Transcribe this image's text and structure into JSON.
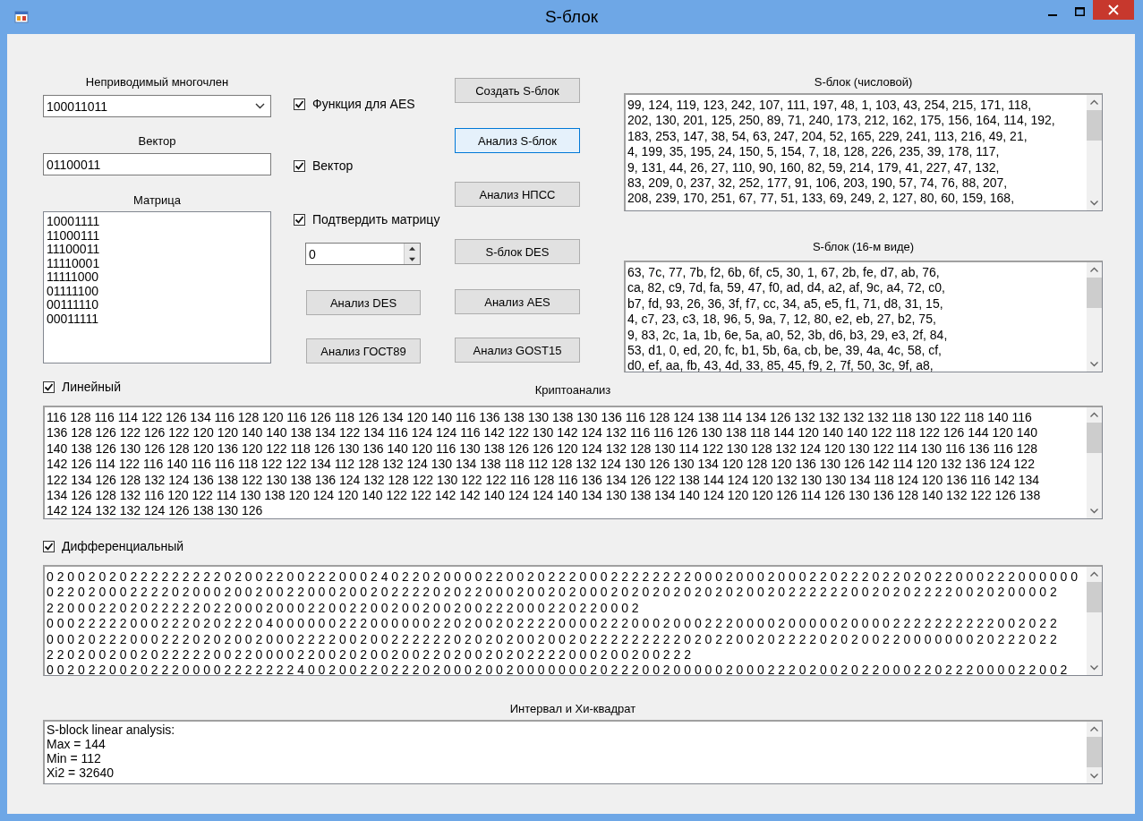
{
  "window": {
    "title": "S-блок"
  },
  "poly": {
    "label": "Неприводимый многочлен",
    "value": "100011011"
  },
  "vector": {
    "label": "Вектор",
    "value": "01100011"
  },
  "matrix": {
    "label": "Матрица",
    "rows": [
      "10001111",
      "11000111",
      "11100011",
      "11110001",
      "11111000",
      "01111100",
      "00111110",
      "00011111"
    ]
  },
  "options": [
    {
      "label": "Функция для AES",
      "checked": true
    },
    {
      "label": "Вектор",
      "checked": true
    },
    {
      "label": "Подтвердить матрицу",
      "checked": true
    }
  ],
  "spinner": {
    "value": "0"
  },
  "buttons_left": [
    {
      "label": "Анализ DES",
      "highlighted": false
    },
    {
      "label": "Анализ ГОСТ89",
      "highlighted": false
    }
  ],
  "buttons_right": [
    {
      "label": "Создать S-блок",
      "highlighted": false
    },
    {
      "label": "Анализ S-блок",
      "highlighted": true
    },
    {
      "label": "Анализ НПСС",
      "highlighted": false
    },
    {
      "label": "S-блок DES",
      "highlighted": false
    },
    {
      "label": "Анализ AES",
      "highlighted": false
    },
    {
      "label": "Анализ GOST15",
      "highlighted": false
    }
  ],
  "sbox_dec": {
    "label": "S-блок (числовой)",
    "lines": [
      "99, 124, 119, 123, 242, 107, 111, 197, 48, 1, 103, 43, 254, 215, 171, 118,",
      "202, 130, 201, 125, 250, 89, 71, 240, 173, 212, 162, 175, 156, 164, 114, 192,",
      "183, 253, 147, 38, 54, 63, 247, 204, 52, 165, 229, 241, 113, 216, 49, 21,",
      "4, 199, 35, 195, 24, 150, 5, 154, 7, 18, 128, 226, 235, 39, 178, 117,",
      "9, 131, 44, 26, 27, 110, 90, 160, 82, 59, 214, 179, 41, 227, 47, 132,",
      "83, 209, 0, 237, 32, 252, 177, 91, 106, 203, 190, 57, 74, 76, 88, 207,",
      "208, 239, 170, 251, 67, 77, 51, 133, 69, 249, 2, 127, 80, 60, 159, 168,"
    ]
  },
  "sbox_hex": {
    "label": "S-блок (16-м виде)",
    "lines": [
      "63, 7c, 77, 7b, f2, 6b, 6f, c5, 30, 1, 67, 2b, fe, d7, ab, 76,",
      "ca, 82, c9, 7d, fa, 59, 47, f0, ad, d4, a2, af, 9c, a4, 72, c0,",
      "b7, fd, 93, 26, 36, 3f, f7, cc, 34, a5, e5, f1, 71, d8, 31, 15,",
      "4, c7, 23, c3, 18, 96, 5, 9a, 7, 12, 80, e2, eb, 27, b2, 75,",
      "9, 83, 2c, 1a, 1b, 6e, 5a, a0, 52, 3b, d6, b3, 29, e3, 2f, 84,",
      "53, d1, 0, ed, 20, fc, b1, 5b, 6a, cb, be, 39, 4a, 4c, 58, cf,",
      "d0, ef, aa, fb, 43, 4d, 33, 85, 45, f9, 2, 7f, 50, 3c, 9f, a8,"
    ]
  },
  "linear": {
    "checkbox": {
      "label": "Линейный",
      "checked": true
    },
    "label": "Криптоанализ",
    "lines": [
      "116 128 116 114 122 126 134 116 128 120 116 126 118 126 134 120 140 116 136 138 130 138 130 136 116 128 124 138 114 134 126 132 132 132 132 118 130 122 118 140 116",
      "136 128 126 122 126 122 120 120 140 140 138 134 122 134 116 124 124 116 142 122 130 142 124 132 116 116 126 130 138 118 144 120 140 140 122 118 122 126 144 120 140",
      "140 138 126 130 126 128 120 136 120 122 118 126 130 136 140 120 116 130 138 126 126 120 124 132 128 130 114 122 130 128 132 124 120 130 122 114 130 116 136 116 128",
      "142 126 114 122 116 140 116 116 118 122 122 134 112 128 132 124 130 134 138 118 112 128 132 124 130 126 130 134 120 128 120 136 130 126 142 114 120 132 136 124 122",
      "122 134 126 128 132 124 136 138 122 130 138 136 124 132 128 122 130 122 122 116 128 116 136 134 126 122 138 144 124 120 132 130 130 134 118 124 120 136 116 142 134",
      "134 126 128 132 116 120 122 114 130 138 120 124 120 140 122 122 142 142 140 124 124 140 134 130 138 134 140 124 120 120 126 114 126 130 136 128 140 132 122 126 138",
      "142 124 132 132 124 126 138 130 126"
    ]
  },
  "differential": {
    "checkbox": {
      "label": "Дифференциальный",
      "checked": true
    },
    "lines": [
      "0 2 0 0 2 0 2 0 2 2 2 2 2 2 2 2 2 0 2 0 0 2 2 0 0 2 2 2 0 0 0 2 4 0 2 2 0 2 0 0 0 0 2 2 0 0 2 0 2 2 2 0 0 0 2 2 2 2 2 2 2 2 0 0 0 2 0 0 0 2 0 0 0 2 2 0 2 2 2 0 2 2 0 2 0 2 2 0 0 0 2 2 2 0 0 0 0 0 0",
      "0 2 2 0 2 0 0 0 2 2 2 2 0 2 0 0 0 2 0 0 2 0 0 2 2 0 0 0 2 0 0 2 0 2 2 2 2 0 2 0 2 2 0 0 0 2 0 0 2 0 2 0 0 0 2 0 2 0 2 0 2 0 2 0 2 0 2 0 0 2 0 2 2 2 2 2 2 0 0 2 0 2 0 2 2 2 2 0 0 2 0 2 0 0 0 0 2",
      "2 2 0 0 0 2 2 0 2 0 2 2 2 2 2 0 2 2 0 0 0 2 0 0 0 2 2 0 0 2 2 0 0 2 0 0 2 0 0 2 0 0 2 2 2 0 0 0 2 2 0 2 2 0 0 0 2",
      "0 0 0 2 2 2 2 2 0 0 0 2 2 2 0 2 0 2 2 2 0 4 0 0 0 0 0 0 2 2 2 0 0 0 0 0 0 2 2 0 2 0 0 2 0 2 2 2 2 0 0 0 0 2 2 2 0 0 0 2 0 0 0 2 2 2 0 0 0 0 2 0 0 0 0 0 2 0 0 0 0 2 2 2 2 2 2 2 2 2 2 0 0 2 0 2 2",
      "0 0 0 2 0 2 2 2 0 0 0 2 2 2 0 2 0 2 0 0 2 0 0 0 2 2 2 2 0 0 2 0 0 2 2 2 2 2 2 0 2 0 2 0 2 0 0 2 0 0 2 0 2 2 2 2 2 2 2 2 2 0 2 0 2 2 0 0 2 0 2 2 2 2 0 2 0 2 0 0 2 2 0 0 0 0 0 0 0 2 0 2 2 2 0 2 2",
      "2 2 0 2 0 0 2 0 0 2 0 2 2 2 2 2 0 0 2 2 0 0 0 0 2 2 0 0 2 0 2 0 0 2 0 0 2 2 0 2 0 0 2 0 2 0 2 2 2 2 0 0 0 2 0 0 2 0 0 2 2 2",
      "0 0 2 0 2 2 0 0 2 0 2 2 2 0 0 0 0 2 2 2 2 2 2 2 4 0 0 2 0 0 2 2 0 2 2 2 0 2 0 0 0 2 0 0 2 0 0 0 0 0 0 0 2 0 2 2 2 0 0 2 0 0 0 0 0 2 0 0 0 2 2 2 0 2 0 0 2 0 2 2 0 0 0 2 2 0 2 2 2 0 0 0 0 2 2 0 0 2"
    ]
  },
  "summary": {
    "label": "Интервал и Хи-квадрат",
    "lines": [
      "S-block linear analysis:",
      "Max = 144",
      "Min = 112",
      "Xi2 = 32640"
    ]
  }
}
